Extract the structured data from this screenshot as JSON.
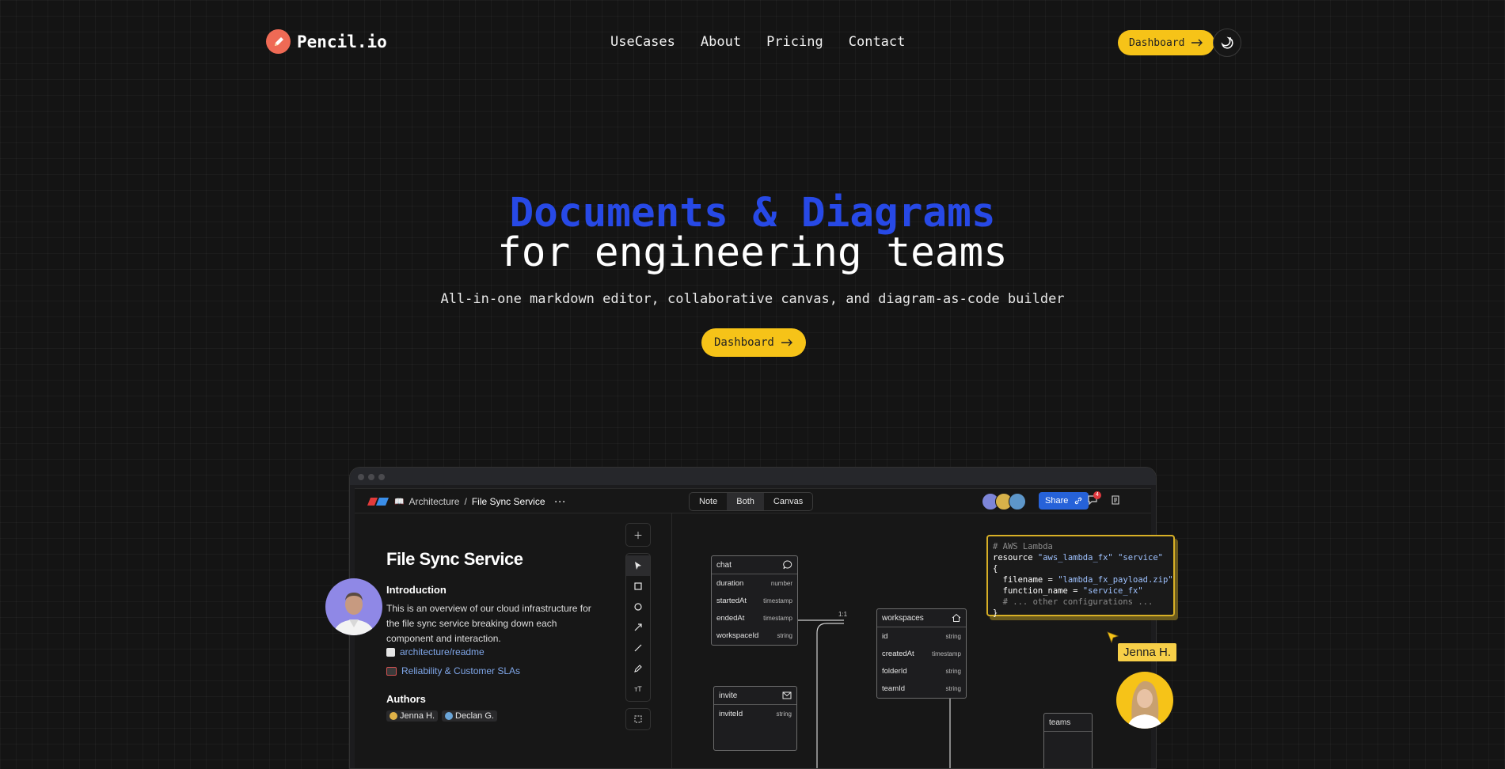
{
  "header": {
    "brand": "Pencil.io",
    "nav": [
      "UseCases",
      "About",
      "Pricing",
      "Contact"
    ],
    "cta": "Dashboard"
  },
  "hero": {
    "title_accent": "Documents & Diagrams",
    "title_rest": "for engineering teams",
    "subtitle": "All-in-one markdown editor, collaborative canvas, and diagram-as-code builder",
    "cta": "Dashboard"
  },
  "app": {
    "breadcrumb_parent": "Architecture",
    "breadcrumb_sep": "/",
    "breadcrumb_current": "File Sync Service",
    "view_modes": [
      "Note",
      "Both",
      "Canvas"
    ],
    "active_view": "Both",
    "share_label": "Share",
    "notification_count": "4",
    "doc": {
      "title": "File Sync Service",
      "intro_heading": "Introduction",
      "intro_text": "This is an overview of our cloud infrastructure for the file sync service breaking down each component and interaction.",
      "links": [
        "architecture/readme",
        "Reliability & Customer SLAs"
      ],
      "authors_heading": "Authors",
      "authors": [
        "Jenna H.",
        "Declan G."
      ]
    },
    "tables": {
      "chat": {
        "name": "chat",
        "rows": [
          [
            "duration",
            "number"
          ],
          [
            "startedAt",
            "timestamp"
          ],
          [
            "endedAt",
            "timestamp"
          ],
          [
            "workspaceId",
            "string"
          ]
        ]
      },
      "workspaces": {
        "name": "workspaces",
        "rows": [
          [
            "id",
            "string"
          ],
          [
            "createdAt",
            "timestamp"
          ],
          [
            "folderId",
            "string"
          ],
          [
            "teamId",
            "string"
          ]
        ]
      },
      "invite": {
        "name": "invite",
        "rows": [
          [
            "inviteId",
            "string"
          ]
        ]
      },
      "teams": {
        "name": "teams"
      }
    },
    "relation_label": "1:1",
    "code": {
      "line1": "# AWS Lambda",
      "line2a": "resource ",
      "line2b": "\"aws_lambda_fx\"",
      "line2c": " ",
      "line2d": "\"service\"",
      "line2e": " {",
      "line3a": "  filename = ",
      "line3b": "\"lambda_fx_payload.zip\"",
      "line4a": "  function_name = ",
      "line4b": "\"service_fx\"",
      "line5": "  # ... other configurations ...",
      "line6": "}"
    },
    "cursor_name": "Jenna H."
  },
  "colors": {
    "accent_blue": "#2749e6",
    "cta_yellow": "#f6c318",
    "share_blue": "#2662d9",
    "code_border": "#d8b026"
  },
  "icons": [
    "pencil-logo-icon",
    "arrow-right-icon",
    "moon-stars-icon",
    "book-icon",
    "more-icon",
    "link-icon",
    "comment-icon",
    "export-icon",
    "plus-icon",
    "cursor-icon",
    "square-icon",
    "circle-icon",
    "arrow-icon",
    "line-icon",
    "pen-icon",
    "text-size-icon",
    "select-icon",
    "chat-bubble-icon",
    "home-icon",
    "mail-icon"
  ]
}
